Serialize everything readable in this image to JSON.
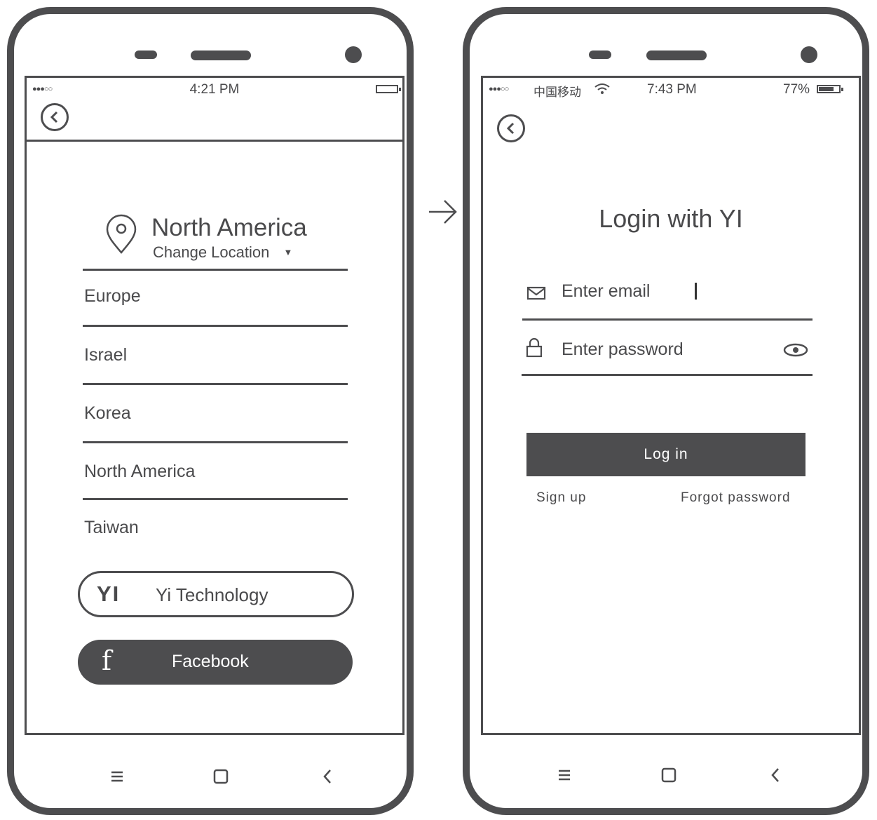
{
  "left_screen": {
    "status": {
      "signal": "●●●○○",
      "time": "4:21 PM",
      "battery_level": 0
    },
    "location": {
      "title": "North America",
      "subtitle": "Change Location",
      "caret": "▼"
    },
    "regions": [
      "Europe",
      "Israel",
      "Korea",
      "North America",
      "Taiwan"
    ],
    "yi_button": {
      "logo": "YI",
      "label": "Yi Technology"
    },
    "facebook_button": {
      "logo": "f",
      "label": "Facebook"
    }
  },
  "right_screen": {
    "status": {
      "signal": "●●●○○",
      "carrier": "中国移动",
      "time": "7:43 PM",
      "battery_text": "77%",
      "battery_level": 0.77
    },
    "title": "Login with YI",
    "email_placeholder": "Enter email",
    "password_placeholder": "Enter password",
    "login_label": "Log in",
    "signup_label": "Sign up",
    "forgot_label": "Forgot password"
  },
  "colors": {
    "frame": "#4d4d4f",
    "text": "#4a4a4c",
    "button_bg": "#4d4d4f",
    "button_text": "#ffffff"
  },
  "icons": [
    "chevron-left-icon",
    "location-pin-icon",
    "mail-icon",
    "lock-icon",
    "eye-icon",
    "menu-icon",
    "home-square-icon",
    "back-caret-icon",
    "wifi-icon",
    "arrow-right-icon"
  ]
}
